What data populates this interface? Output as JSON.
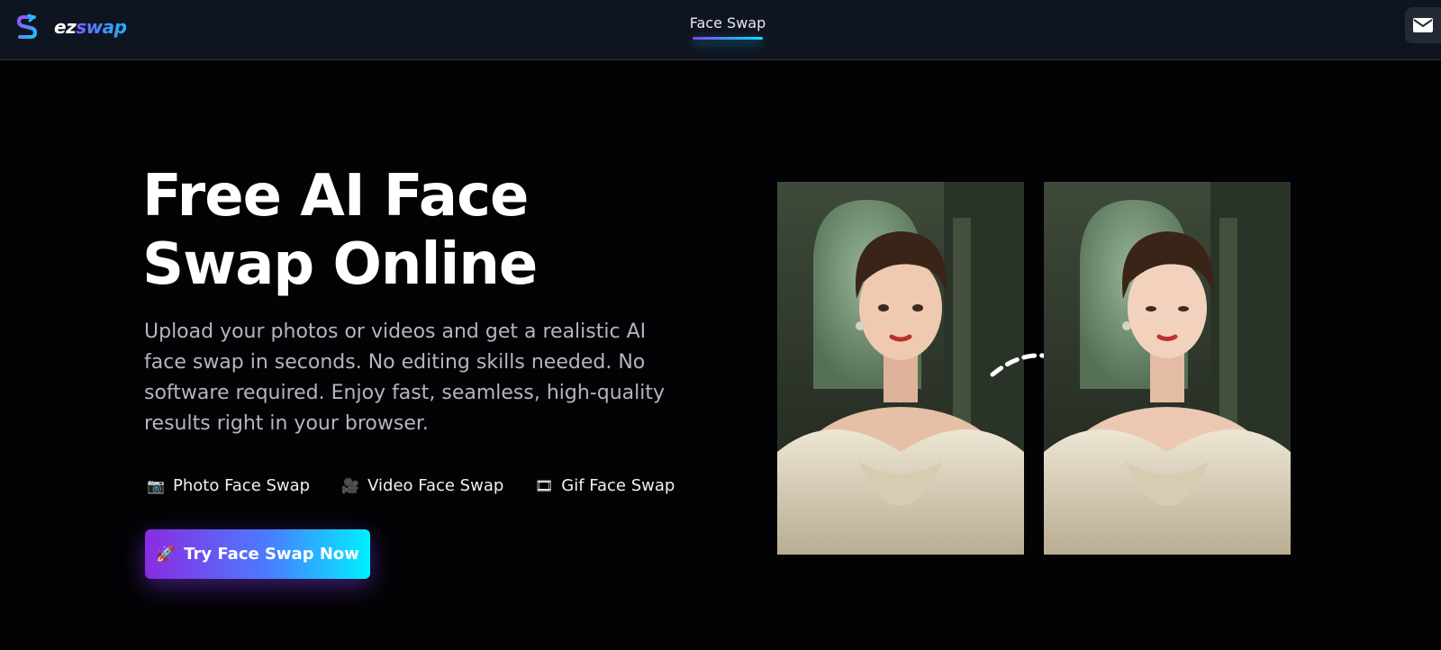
{
  "header": {
    "logo": {
      "part1": "ez",
      "part2": "swap",
      "icon": "ezswap-logo-icon"
    },
    "nav": [
      {
        "label": "Face Swap",
        "active": true
      }
    ],
    "mail_icon": "mail-icon"
  },
  "hero": {
    "title_line1": "Free AI Face",
    "title_line2": "Swap Online",
    "description": "Upload your photos or videos and get a realistic AI face swap in seconds. No editing skills needed. No software required. Enjoy fast, seamless, high-quality results right in your browser.",
    "features": [
      {
        "icon": "camera-icon",
        "glyph": "📷",
        "label": "Photo Face Swap"
      },
      {
        "icon": "video-camera-icon",
        "glyph": "🎥",
        "label": "Video Face Swap"
      },
      {
        "icon": "film-frames-icon",
        "glyph": "🎞",
        "label": "Gif Face Swap"
      }
    ],
    "cta": {
      "icon": "rocket-icon",
      "glyph": "🚀",
      "label": "Try Face Swap Now"
    }
  },
  "colors": {
    "background": "#030305",
    "header": "#0f1520",
    "accent_start": "#8a2be2",
    "accent_end": "#00f0ff"
  }
}
